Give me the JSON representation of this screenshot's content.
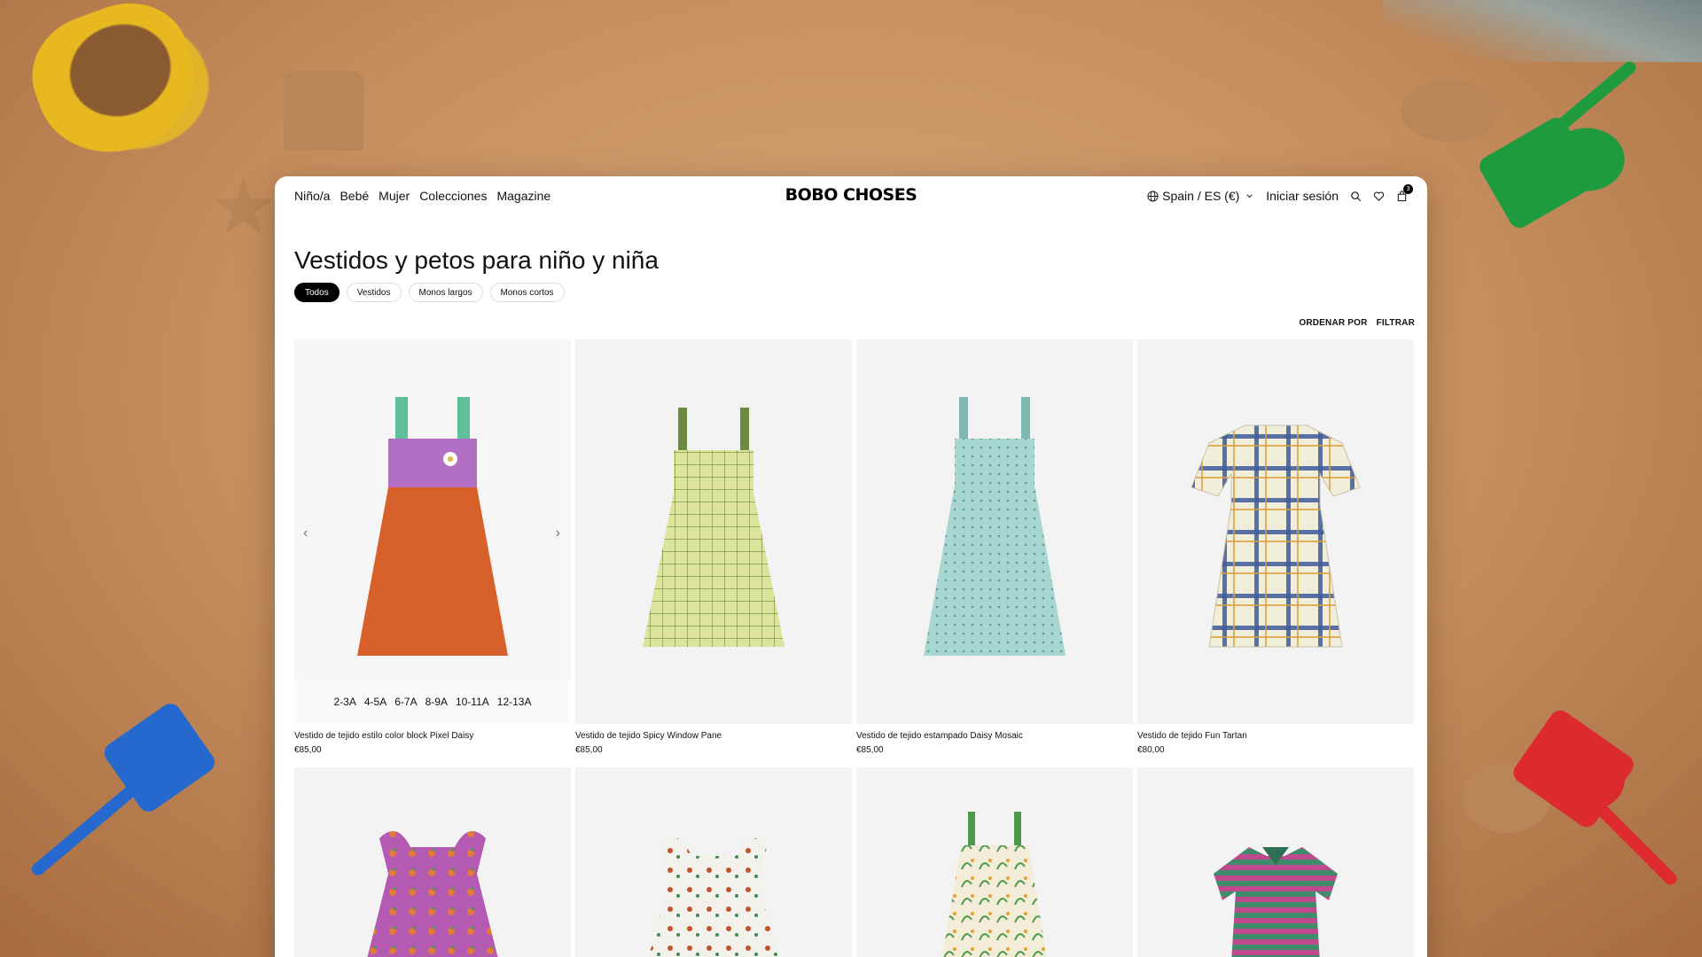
{
  "nav": {
    "links": [
      "Niño/a",
      "Bebé",
      "Mujer",
      "Colecciones",
      "Magazine"
    ],
    "logo": "BOBO CHOSES",
    "locale": "Spain / ES (€)",
    "login": "Iniciar sesión",
    "cart_count": "3",
    "icons": [
      "globe-icon",
      "chevron-down-icon",
      "search-icon",
      "heart-icon",
      "bag-icon"
    ]
  },
  "page": {
    "title": "Vestidos y petos para niño y niña",
    "filters": [
      "Todos",
      "Vestidos",
      "Monos largos",
      "Monos cortos"
    ],
    "active_filter": "Todos",
    "sort_label": "ORDENAR POR",
    "filter_label": "FILTRAR"
  },
  "products": [
    {
      "name": "Vestido de tejido estilo color block Pixel Daisy",
      "price": "€85,00",
      "sizes": [
        "2-3A",
        "4-5A",
        "6-7A",
        "8-9A",
        "10-11A",
        "12-13A"
      ]
    },
    {
      "name": "Vestido de tejido Spicy Window Pane",
      "price": "€85,00"
    },
    {
      "name": "Vestido de tejido estampado Daisy Mosaic",
      "price": "€85,00"
    },
    {
      "name": "Vestido de tejido Fun Tartan",
      "price": "€80,00"
    }
  ],
  "colors": {
    "accent": "#000000",
    "background_panel": "#ffffff",
    "card_bg": "#f3f3f3"
  }
}
